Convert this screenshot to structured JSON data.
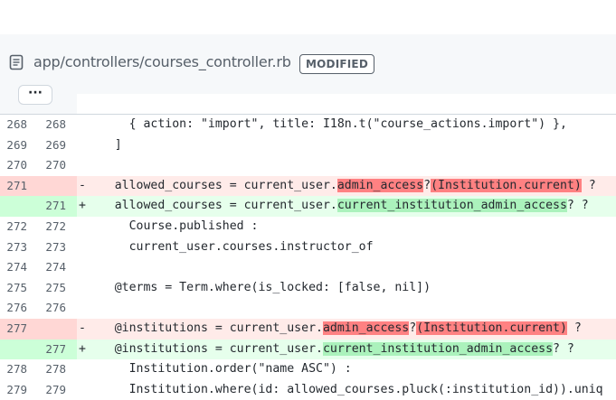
{
  "file": {
    "path": "app/controllers/courses_controller.rb",
    "status": "MODIFIED",
    "expand_label": "···",
    "icon": "file-icon"
  },
  "colors": {
    "deleted_bg": "#ffebe9",
    "deleted_gutter": "#ffd7d5",
    "deleted_highlight": "#ff8182",
    "added_bg": "#e6ffec",
    "added_gutter": "#ccffd8",
    "added_highlight": "#abf2bc"
  },
  "lines": [
    {
      "type": "ctx",
      "old": "268",
      "new": "268",
      "marker": "",
      "parts": [
        {
          "t": "      { action: \"import\", title: I18n.t(\"course_actions.import\") },"
        }
      ]
    },
    {
      "type": "ctx",
      "old": "269",
      "new": "269",
      "marker": "",
      "parts": [
        {
          "t": "    ]"
        }
      ]
    },
    {
      "type": "ctx",
      "old": "270",
      "new": "270",
      "marker": "",
      "parts": [
        {
          "t": ""
        }
      ]
    },
    {
      "type": "del",
      "old": "271",
      "new": "",
      "marker": "-",
      "parts": [
        {
          "t": "    allowed_courses = current_user."
        },
        {
          "t": "admin_access",
          "h": true
        },
        {
          "t": "?"
        },
        {
          "t": "(Institution.current)",
          "h": true
        },
        {
          "t": " ?"
        }
      ]
    },
    {
      "type": "add",
      "old": "",
      "new": "271",
      "marker": "+",
      "parts": [
        {
          "t": "    allowed_courses = current_user."
        },
        {
          "t": "current_institution_admin_access",
          "h": true
        },
        {
          "t": "? ?"
        }
      ]
    },
    {
      "type": "ctx",
      "old": "272",
      "new": "272",
      "marker": "",
      "parts": [
        {
          "t": "      Course.published :"
        }
      ]
    },
    {
      "type": "ctx",
      "old": "273",
      "new": "273",
      "marker": "",
      "parts": [
        {
          "t": "      current_user.courses.instructor_of"
        }
      ]
    },
    {
      "type": "ctx",
      "old": "274",
      "new": "274",
      "marker": "",
      "parts": [
        {
          "t": ""
        }
      ]
    },
    {
      "type": "ctx",
      "old": "275",
      "new": "275",
      "marker": "",
      "parts": [
        {
          "t": "    @terms = Term.where(is_locked: [false, nil])"
        }
      ]
    },
    {
      "type": "ctx",
      "old": "276",
      "new": "276",
      "marker": "",
      "parts": [
        {
          "t": ""
        }
      ]
    },
    {
      "type": "del",
      "old": "277",
      "new": "",
      "marker": "-",
      "parts": [
        {
          "t": "    @institutions = current_user."
        },
        {
          "t": "admin_access",
          "h": true
        },
        {
          "t": "?"
        },
        {
          "t": "(Institution.current)",
          "h": true
        },
        {
          "t": " ?"
        }
      ]
    },
    {
      "type": "add",
      "old": "",
      "new": "277",
      "marker": "+",
      "parts": [
        {
          "t": "    @institutions = current_user."
        },
        {
          "t": "current_institution_admin_access",
          "h": true
        },
        {
          "t": "? ?"
        }
      ]
    },
    {
      "type": "ctx",
      "old": "278",
      "new": "278",
      "marker": "",
      "parts": [
        {
          "t": "      Institution.order(\"name ASC\") :"
        }
      ]
    },
    {
      "type": "ctx",
      "old": "279",
      "new": "279",
      "marker": "",
      "parts": [
        {
          "t": "      Institution.where(id: allowed_courses.pluck(:institution_id)).uniq"
        }
      ]
    }
  ]
}
